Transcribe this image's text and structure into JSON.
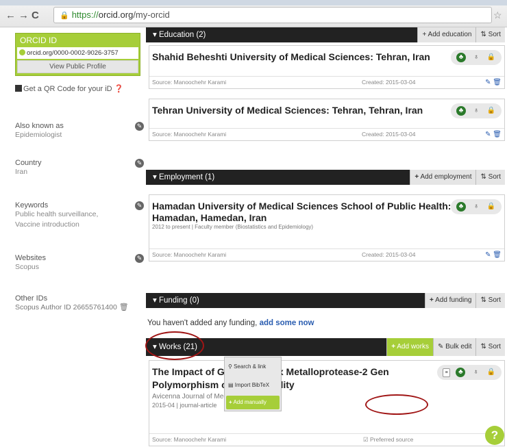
{
  "browser": {
    "url_https": "https://",
    "url_host": "orcid.org",
    "url_path": "/my-orcid"
  },
  "sidebar": {
    "orcid_id_title": "ORCID ID",
    "orcid_url": "orcid.org/0000-0002-9026-3757",
    "view_public_profile": "View Public Profile",
    "qr_code_link": "Get a QR Code for your iD",
    "also_known_as_label": "Also known as",
    "also_known_as_value": "Epidemiologist",
    "country_label": "Country",
    "country_value": "Iran",
    "keywords_label": "Keywords",
    "keywords_value_1": "Public health surveillance,",
    "keywords_value_2": "Vaccine introduction",
    "websites_label": "Websites",
    "websites_value": "Scopus",
    "other_ids_label": "Other IDs",
    "other_ids_value": "Scopus Author ID 26655761400"
  },
  "education": {
    "header": "Education (2)",
    "add_label": "+ Add education",
    "sort_label": "Sort",
    "items": [
      {
        "title": "Shahid Beheshti University of Medical Sciences: Tehran, Iran",
        "source": "Source: Manoochehr Karami",
        "created": "Created: 2015-03-04"
      },
      {
        "title": "Tehran University of Medical Sciences: Tehran, Tehran, Iran",
        "source": "Source: Manoochehr Karami",
        "created": "Created: 2015-03-04"
      }
    ]
  },
  "employment": {
    "header": "Employment (1)",
    "add_label": "Add employment",
    "sort_label": "Sort",
    "item": {
      "title_1": "Hamadan University of Medical Sciences School of Public Health:",
      "title_2": "Hamadan, Hamedan, Iran",
      "meta": "2012 to present | Faculty member (Biostatistics and Epidemiology)",
      "source": "Source: Manoochehr Karami",
      "created": "Created: 2015-03-04"
    }
  },
  "funding": {
    "header": "Funding (0)",
    "add_label": "Add funding",
    "sort_label": "Sort",
    "empty_text": "You haven't added any funding,",
    "add_some_now": "add some now"
  },
  "works": {
    "header": "Works (21)",
    "add_label": "Add works",
    "bulk_edit_label": "Bulk edit",
    "sort_label": "Sort",
    "menu": {
      "search_link": "Search & link",
      "import_bibtex": "Import BibTeX",
      "add_manually": "Add manually"
    },
    "item": {
      "title_1": "The Impact of G1575A Matrix Metalloprotease-2 Gen",
      "title_2": "Polymorphism on Male Fertility",
      "journal": "Avicenna Journal of Medical Biochemistry",
      "meta": "2015-04 | journal-article",
      "source": "Source: Manoochehr Karami",
      "preferred": "Preferred source"
    }
  },
  "help_button": "?",
  "colors": {
    "orcid_green": "#a6ce39",
    "section_bar": "#222222",
    "annotation_red": "#a01515"
  }
}
